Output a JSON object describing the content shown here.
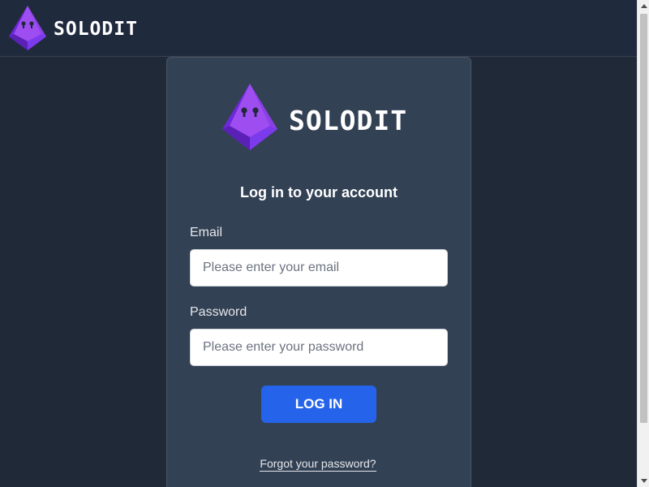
{
  "header": {
    "brand": "SOLODIT"
  },
  "card": {
    "brand": "SOLODIT",
    "title": "Log in to your account",
    "email": {
      "label": "Email",
      "placeholder": "Please enter your email",
      "value": ""
    },
    "password": {
      "label": "Password",
      "placeholder": "Please enter your password",
      "value": ""
    },
    "login_button": "LOG IN",
    "forgot_link": "Forgot your password?",
    "signup_text": ""
  },
  "colors": {
    "background": "#1f2937",
    "header": "#202a3d",
    "card": "#334155",
    "primary_button": "#2563eb",
    "logo_purple": "#8b3fe6",
    "logo_purple_dark": "#6d28d9"
  },
  "icons": {
    "brand_logo": "purple-diamond-keyhole-icon"
  }
}
